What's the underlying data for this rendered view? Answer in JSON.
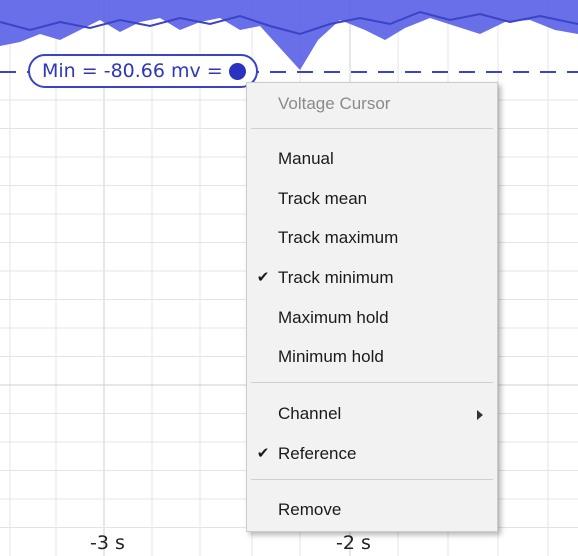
{
  "cursor": {
    "label": "Min = -80.66 mv ="
  },
  "x_axis": {
    "ticks": [
      "-3 s",
      "-2 s"
    ]
  },
  "colors": {
    "trace": "#3b43c6",
    "trace_band": "#5b63e6",
    "grid": "#e4e4e4"
  },
  "context_menu": {
    "header": "Voltage Cursor",
    "items": [
      {
        "label": "Manual",
        "checked": false
      },
      {
        "label": "Track mean",
        "checked": false
      },
      {
        "label": "Track maximum",
        "checked": false
      },
      {
        "label": "Track minimum",
        "checked": true
      },
      {
        "label": "Maximum hold",
        "checked": false
      },
      {
        "label": "Minimum hold",
        "checked": false
      },
      {
        "label": "Channel",
        "checked": false,
        "submenu": true
      },
      {
        "label": "Reference",
        "checked": true
      },
      {
        "label": "Remove",
        "checked": false
      }
    ],
    "check_glyph": "✔"
  }
}
